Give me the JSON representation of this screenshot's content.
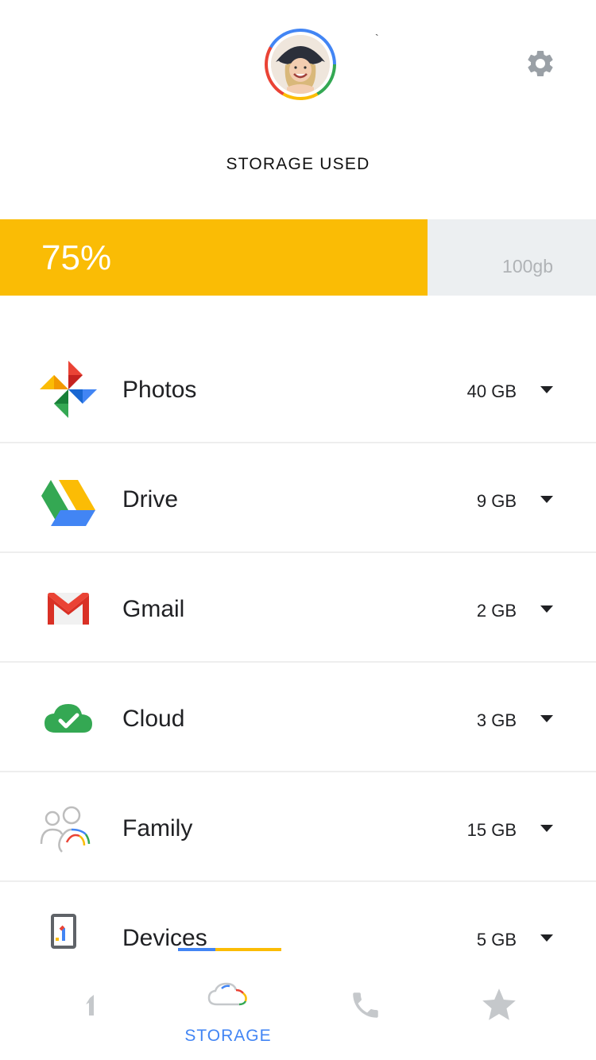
{
  "header": {
    "avatar_alt": "profile photo",
    "tick_mark": "`",
    "settings_icon": "gear-icon"
  },
  "storage": {
    "title": "STORAGE USED",
    "percent_label": "75%",
    "percent_value": 0.75,
    "total_label": "100gb",
    "bar_color": "#fabc05"
  },
  "services": [
    {
      "name": "Photos",
      "size": "40 GB",
      "icon": "google-photos-icon"
    },
    {
      "name": "Drive",
      "size": "9 GB",
      "icon": "google-drive-icon"
    },
    {
      "name": "Gmail",
      "size": "2 GB",
      "icon": "gmail-icon"
    },
    {
      "name": "Cloud",
      "size": "3 GB",
      "icon": "cloud-check-icon"
    },
    {
      "name": "Family",
      "size": "15 GB",
      "icon": "family-icon"
    },
    {
      "name": "Devices",
      "size": "5 GB",
      "icon": "devices-icon"
    }
  ],
  "bottom_nav": {
    "items": [
      {
        "icon": "google-one-icon",
        "label": ""
      },
      {
        "icon": "cloud-icon",
        "label": "STORAGE",
        "active": true
      },
      {
        "icon": "phone-icon",
        "label": ""
      },
      {
        "icon": "star-icon",
        "label": ""
      }
    ]
  },
  "colors": {
    "accent_blue": "#4285f4",
    "accent_yellow": "#fabc05",
    "bar_background": "#eceff1",
    "inactive_icon": "#c5c8cb"
  }
}
